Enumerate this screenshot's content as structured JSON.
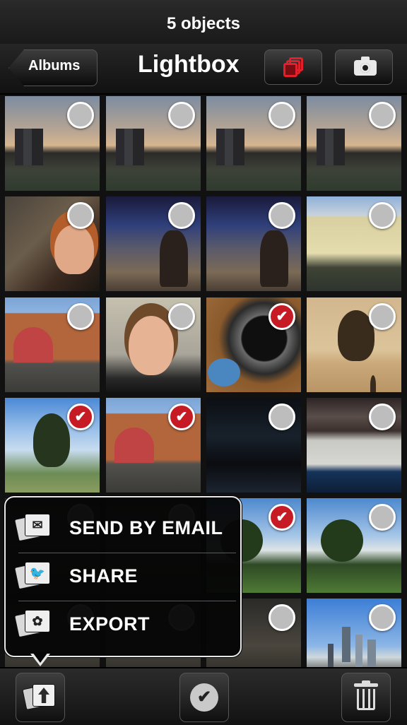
{
  "status": {
    "text": "5 objects"
  },
  "nav": {
    "back_label": "Albums",
    "title": "Lightbox",
    "stack_button": "stack-icon",
    "camera_button": "camera-icon"
  },
  "grid": {
    "photos": [
      {
        "style": "p-sky",
        "selected": false
      },
      {
        "style": "p-sky",
        "selected": false
      },
      {
        "style": "p-sky",
        "selected": false
      },
      {
        "style": "p-sky",
        "selected": false
      },
      {
        "style": "p-woman1",
        "selected": false
      },
      {
        "style": "p-bar",
        "selected": false
      },
      {
        "style": "p-bar",
        "selected": false
      },
      {
        "style": "p-building",
        "selected": false
      },
      {
        "style": "p-brick",
        "selected": false
      },
      {
        "style": "p-selfie",
        "selected": false
      },
      {
        "style": "p-mortar",
        "selected": true
      },
      {
        "style": "p-tree-sepia",
        "selected": false
      },
      {
        "style": "p-tree-sky",
        "selected": true
      },
      {
        "style": "p-brick",
        "selected": true
      },
      {
        "style": "p-dark1",
        "selected": false
      },
      {
        "style": "p-dark2",
        "selected": false
      },
      {
        "style": "p-dark3",
        "selected": false
      },
      {
        "style": "p-dark3",
        "selected": false
      },
      {
        "style": "p-park",
        "selected": true
      },
      {
        "style": "p-park",
        "selected": false
      },
      {
        "style": "p-dark3",
        "selected": false
      },
      {
        "style": "p-dark3",
        "selected": false
      },
      {
        "style": "p-dark3",
        "selected": false
      },
      {
        "style": "p-city",
        "selected": false
      }
    ]
  },
  "popover": {
    "items": [
      {
        "label": "SEND BY EMAIL",
        "icon": "envelope-icon",
        "glyph": "✉"
      },
      {
        "label": "SHARE",
        "icon": "twitter-bird-icon",
        "glyph": "🐦"
      },
      {
        "label": "EXPORT",
        "icon": "flower-icon",
        "glyph": "✿"
      }
    ]
  },
  "toolbar": {
    "export_icon": "export-icon",
    "check_icon": "checkmark-icon",
    "check_glyph": "✔",
    "trash_icon": "trash-icon"
  },
  "colors": {
    "accent_red": "#c61b24",
    "stack_red": "#e0202a",
    "background": "#000000"
  }
}
